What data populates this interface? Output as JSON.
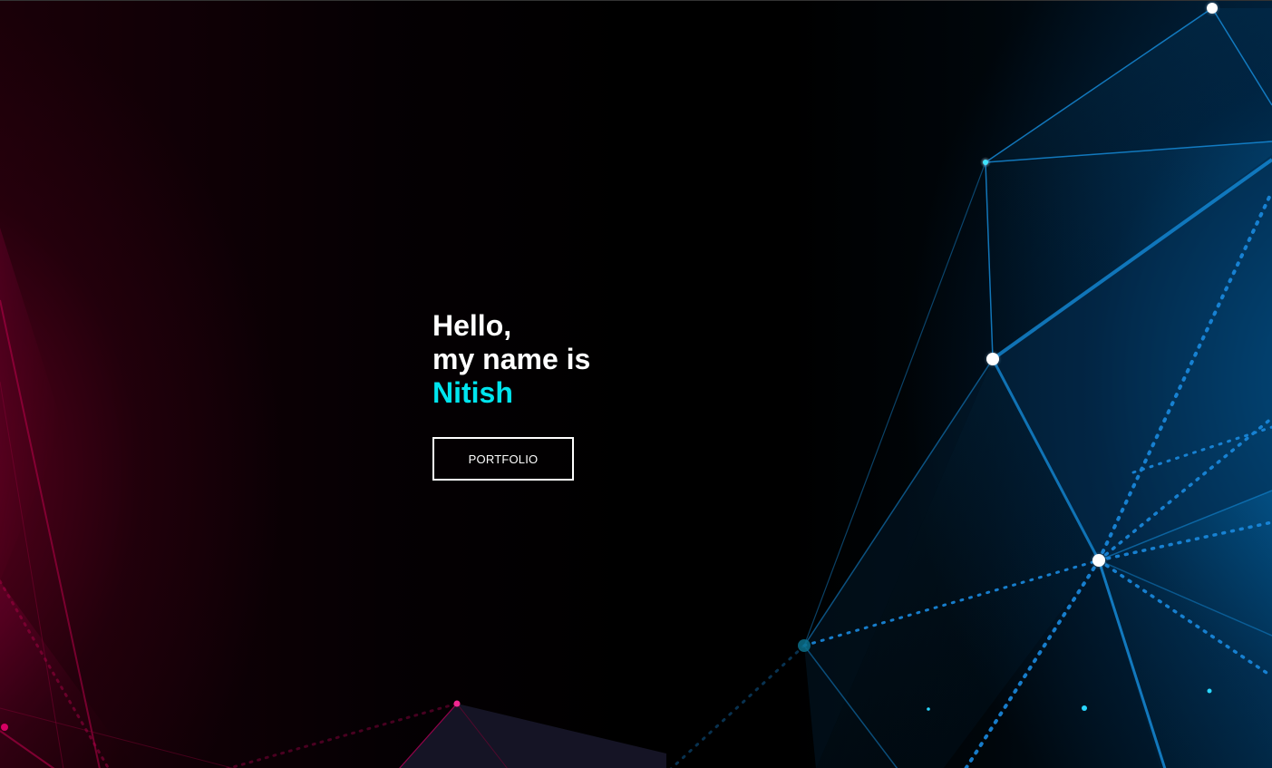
{
  "hero": {
    "greeting": "Hello,",
    "intro": "my name is",
    "name": "Nitish",
    "portfolio_label": "PORTFOLIO"
  },
  "colors": {
    "name_accent": "#00e5ee",
    "network_blue": "#0a7bd1",
    "network_pink": "#d6006e",
    "button_border": "#ffffff"
  }
}
